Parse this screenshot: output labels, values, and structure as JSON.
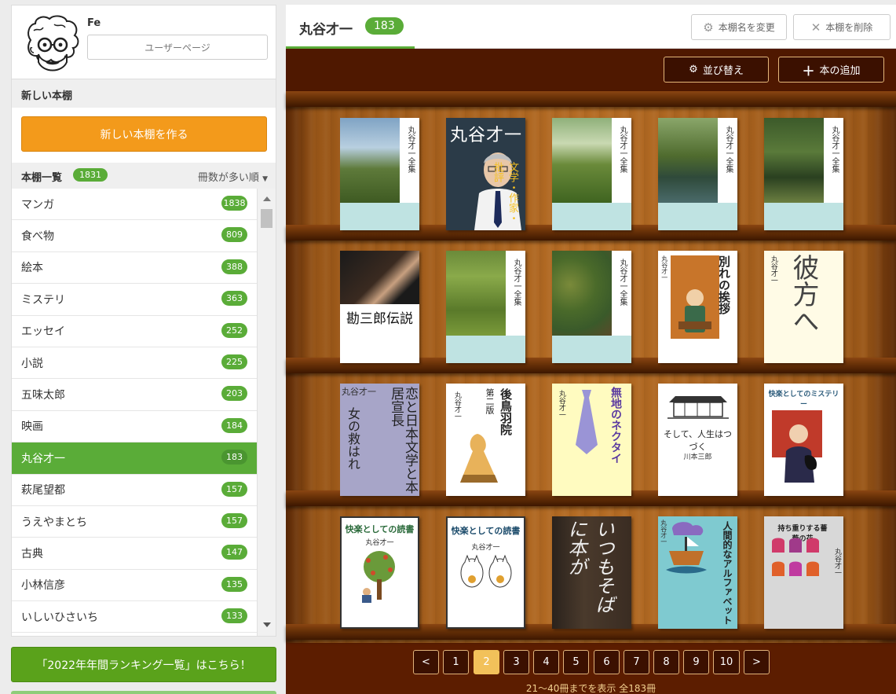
{
  "user": {
    "name": "Fe",
    "userpage_label": "ユーザーページ"
  },
  "new_shelf": {
    "heading": "新しい本棚",
    "button_label": "新しい本棚を作る"
  },
  "shelf_list": {
    "heading": "本棚一覧",
    "total": "1831",
    "sort_label": "冊数が多い順",
    "items": [
      {
        "label": "マンガ",
        "count": "1838"
      },
      {
        "label": "食べ物",
        "count": "809"
      },
      {
        "label": "絵本",
        "count": "388"
      },
      {
        "label": "ミステリ",
        "count": "363"
      },
      {
        "label": "エッセイ",
        "count": "252"
      },
      {
        "label": "小説",
        "count": "225"
      },
      {
        "label": "五味太郎",
        "count": "203"
      },
      {
        "label": "映画",
        "count": "184"
      },
      {
        "label": "丸谷才一",
        "count": "183"
      },
      {
        "label": "萩尾望都",
        "count": "157"
      },
      {
        "label": "うえやまとち",
        "count": "157"
      },
      {
        "label": "古典",
        "count": "147"
      },
      {
        "label": "小林信彦",
        "count": "135"
      },
      {
        "label": "いしいひさいち",
        "count": "133"
      }
    ]
  },
  "ranking_button": "「2022年年間ランキング一覧」はこちら！",
  "current_shelf": {
    "title": "丸谷才一",
    "count": "183",
    "rename_label": "本棚名を変更",
    "delete_label": "本棚を削除",
    "sort_label": "並び替え",
    "add_label": "本の追加"
  },
  "book_texts": {
    "zenshu": "丸谷才一全集",
    "kidan": "丸谷才一",
    "kanzaburo": "勘三郎伝説",
    "wakare": "別れの挨拶",
    "kanata": "彼方へ",
    "koi": "恋と日本文学と本居宣長",
    "onna": "女の救はれ",
    "gotoba": "後鳥羽院",
    "gotoba_ed": "第二版",
    "muji": "無地のネクタイ",
    "soshite": "そして、人生はつづく",
    "kawamoto": "川本三郎",
    "mystery": "快楽としてのミステリー",
    "dokusho": "快楽としての読書",
    "itsumo": "いつもそばに本が",
    "aka": "人間的なアルファベット",
    "mochi": "持ち重りする薔薇の花"
  },
  "pagination": {
    "prev": "<",
    "next": ">",
    "pages": [
      "1",
      "2",
      "3",
      "4",
      "5",
      "6",
      "7",
      "8",
      "9",
      "10"
    ],
    "current": "2",
    "info": "21〜40冊までを表示 全183冊"
  }
}
